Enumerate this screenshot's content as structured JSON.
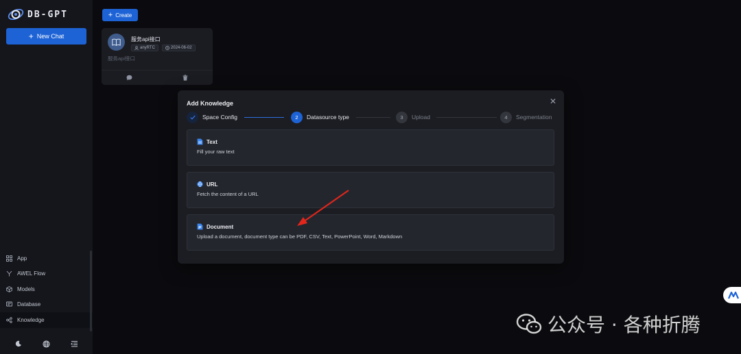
{
  "app": {
    "logo_text": "DB-GPT"
  },
  "sidebar": {
    "new_chat_label": "New Chat",
    "nav_items": [
      {
        "label": "App",
        "icon": "app-grid-icon"
      },
      {
        "label": "AWEL Flow",
        "icon": "flow-icon"
      },
      {
        "label": "Models",
        "icon": "cube-icon"
      },
      {
        "label": "Database",
        "icon": "database-icon"
      },
      {
        "label": "Knowledge",
        "icon": "knowledge-icon",
        "active": true
      }
    ],
    "bottom_icons": [
      "theme-moon-icon",
      "language-globe-icon",
      "collapse-menu-icon"
    ]
  },
  "main": {
    "create_label": "Create",
    "card": {
      "title": "服务api接口",
      "owner": "anyRTC",
      "date": "2024-06-02",
      "description": "服务api接口"
    }
  },
  "modal": {
    "title": "Add Knowledge",
    "steps": [
      {
        "number": "1",
        "label": "Space Config",
        "status": "done"
      },
      {
        "number": "2",
        "label": "Datasource type",
        "status": "active"
      },
      {
        "number": "3",
        "label": "Upload",
        "status": "wait"
      },
      {
        "number": "4",
        "label": "Segmentation",
        "status": "wait"
      }
    ],
    "options": [
      {
        "title": "Text",
        "description": "Fill your raw text",
        "icon": "text-file-icon"
      },
      {
        "title": "URL",
        "description": "Fetch the content of a URL",
        "icon": "url-globe-icon"
      },
      {
        "title": "Document",
        "description": "Upload a document, document type can be PDF, CSV, Text, PowerPoint, Word, Markdown",
        "icon": "document-file-icon"
      }
    ]
  },
  "watermark": {
    "text": "公众号 · 各种折腾"
  },
  "colors": {
    "accent": "#1d63d6",
    "annotation_arrow": "#e3261c",
    "background": "#0b0b0f",
    "sidebar": "#15161c",
    "modal": "#1c1d22"
  }
}
